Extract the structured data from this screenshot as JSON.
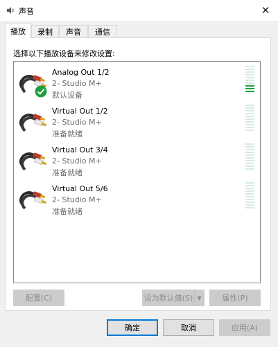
{
  "window": {
    "title": "声音",
    "close_glyph": "✕"
  },
  "tabs": [
    {
      "label": "播放",
      "active": true
    },
    {
      "label": "录制",
      "active": false
    },
    {
      "label": "声音",
      "active": false
    },
    {
      "label": "通信",
      "active": false
    }
  ],
  "instruction": "选择以下播放设备来修改设置:",
  "devices": [
    {
      "name": "Analog Out 1/2",
      "subtitle": "2- Studio M+",
      "status": "默认设备",
      "is_default": true,
      "level_segments_on": 3
    },
    {
      "name": "Virtual Out 1/2",
      "subtitle": "2- Studio M+",
      "status": "准备就绪",
      "is_default": false,
      "level_segments_on": 0
    },
    {
      "name": "Virtual Out 3/4",
      "subtitle": "2- Studio M+",
      "status": "准备就绪",
      "is_default": false,
      "level_segments_on": 0
    },
    {
      "name": "Virtual Out 5/6",
      "subtitle": "2- Studio M+",
      "status": "准备就绪",
      "is_default": false,
      "level_segments_on": 0
    }
  ],
  "buttons": {
    "configure": "配置(C)",
    "set_default": "设为默认值(S)",
    "properties": "属性(P)",
    "ok": "确定",
    "cancel": "取消",
    "apply": "应用(A)"
  },
  "icons": {
    "window": "speaker-icon",
    "device": "rca-cable-icon",
    "default_badge": "green-check-icon"
  },
  "colors": {
    "accent": "#0078d7",
    "default_check": "#1e9f3b",
    "meter_off": "#d6ebe3",
    "meter_on": "#1e9f3b"
  }
}
